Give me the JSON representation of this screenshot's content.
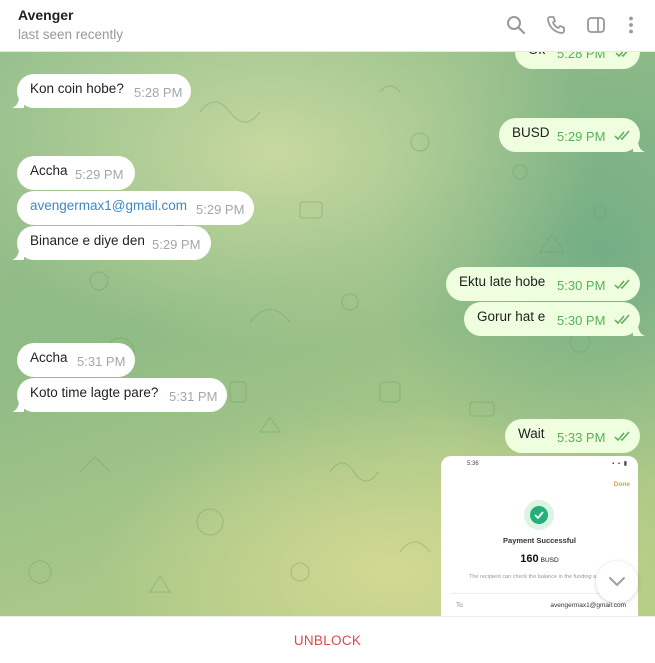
{
  "header": {
    "contact_name": "Avenger",
    "status": "last seen recently",
    "icons": [
      "search-icon",
      "phone-icon",
      "sidebar-toggle-icon",
      "more-vertical-icon"
    ]
  },
  "messages": [
    {
      "dir": "out",
      "text": "Ok",
      "time": "5:28 PM",
      "read": true
    },
    {
      "dir": "in",
      "text": "Kon coin hobe?",
      "time": "5:28 PM"
    },
    {
      "dir": "out",
      "text": "BUSD",
      "time": "5:29 PM",
      "read": true
    },
    {
      "dir": "in",
      "text": "Accha",
      "time": "5:29 PM"
    },
    {
      "dir": "in",
      "text": "avengermax1@gmail.com",
      "time": "5:29 PM",
      "is_link": true
    },
    {
      "dir": "in",
      "text": "Binance e diye den",
      "time": "5:29 PM"
    },
    {
      "dir": "out",
      "text": "Ektu late hobe",
      "time": "5:30 PM",
      "read": true
    },
    {
      "dir": "out",
      "text": "Gorur hat e",
      "time": "5:30 PM",
      "read": true
    },
    {
      "dir": "in",
      "text": "Accha",
      "time": "5:31 PM"
    },
    {
      "dir": "in",
      "text": "Koto time lagte pare?",
      "time": "5:31 PM"
    },
    {
      "dir": "out",
      "text": "Wait",
      "time": "5:33 PM",
      "read": true
    }
  ],
  "screenshot_attachment": {
    "status_time": "5:36",
    "done_label": "Done",
    "title": "Payment Successful",
    "amount": "160",
    "currency": "BUSD",
    "note": "The recipient can check the balance in the funding a",
    "to_label": "To",
    "to_value": "avengermax1@gmail.com"
  },
  "footer": {
    "unblock_label": "UNBLOCK"
  },
  "colors": {
    "incoming_bubble": "#ffffff",
    "outgoing_bubble": "#eefedf",
    "time_out": "#5aaf5a",
    "link": "#3a89c9",
    "unblock": "#d84b4b"
  }
}
